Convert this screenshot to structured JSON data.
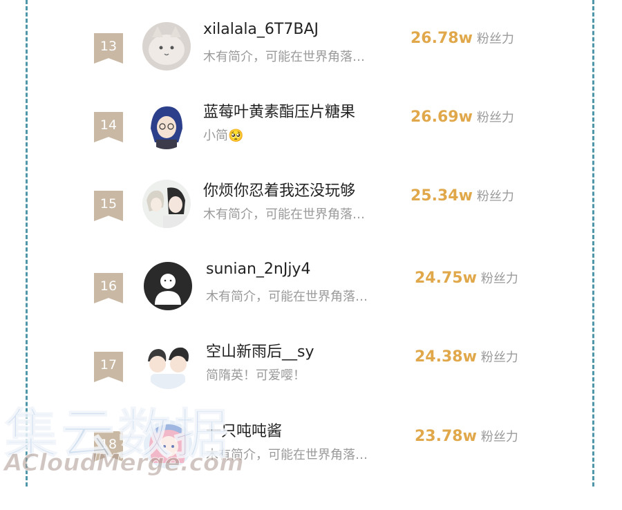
{
  "fans_unit": "粉丝力",
  "watermark": {
    "cn": "集云数据",
    "en": "ACloudMerge.com"
  },
  "colors": {
    "badge": "#c9b8a3",
    "fans": "#e0a84a",
    "border": "#4f97a8"
  },
  "rows": [
    {
      "rank": "13",
      "name": "xilalala_6T7BAJ",
      "bio": "木有简介，可能在世界角落…",
      "fans": "26.78w",
      "avatar": "cat-avatar-icon"
    },
    {
      "rank": "14",
      "name": "蓝莓叶黄素酯压片糖果",
      "bio": "小简🥺",
      "fans": "26.69w",
      "avatar": "anime-boy-avatar-icon"
    },
    {
      "rank": "15",
      "name": "你烦你忍着我还没玩够",
      "bio": "木有简介，可能在世界角落…",
      "fans": "25.34w",
      "avatar": "anime-couple-avatar-icon"
    },
    {
      "rank": "16",
      "name": "sunian_2nJjy4",
      "bio": "木有简介，可能在世界角落…",
      "fans": "24.75w",
      "avatar": "default-avatar-icon"
    },
    {
      "rank": "17",
      "name": "空山新雨后__sy",
      "bio": "简隋英！可爱嘤！",
      "fans": "24.38w",
      "avatar": "chibi-avatar-icon"
    },
    {
      "rank": "18",
      "name": "一只吨吨酱",
      "bio": "木有简介，可能在世界角落…",
      "fans": "23.78w",
      "avatar": "pink-hair-avatar-icon"
    }
  ]
}
